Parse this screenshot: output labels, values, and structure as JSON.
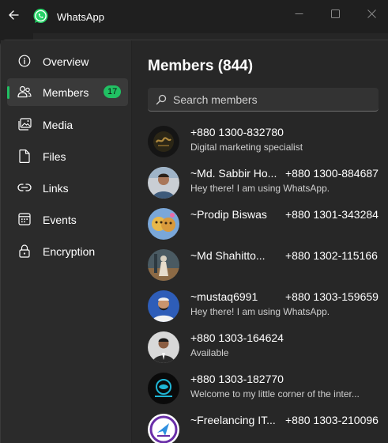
{
  "app": {
    "title": "WhatsApp"
  },
  "sidebar": {
    "items": [
      {
        "label": "Overview",
        "icon": "info-icon"
      },
      {
        "label": "Members",
        "icon": "people-icon",
        "badge": "17",
        "active": true
      },
      {
        "label": "Media",
        "icon": "media-icon"
      },
      {
        "label": "Files",
        "icon": "file-icon"
      },
      {
        "label": "Links",
        "icon": "link-icon"
      },
      {
        "label": "Events",
        "icon": "calendar-icon"
      },
      {
        "label": "Encryption",
        "icon": "lock-icon"
      }
    ]
  },
  "main": {
    "title": "Members (844)",
    "search": {
      "placeholder": "Search members"
    },
    "members": [
      {
        "name": "+880 1300-832780",
        "phone": "",
        "status": "Digital marketing specialist"
      },
      {
        "name": "~Md. Sabbir Ho...",
        "phone": "+880 1300-884687",
        "status": "Hey there! I am using WhatsApp."
      },
      {
        "name": "~Prodip Biswas",
        "phone": "+880 1301-343284",
        "status": ""
      },
      {
        "name": "~Md Shahitto...",
        "phone": "+880 1302-115166",
        "status": ""
      },
      {
        "name": "~mustaq6991",
        "phone": "+880 1303-159659",
        "status": "Hey there! I am using WhatsApp."
      },
      {
        "name": "+880 1303-164624",
        "phone": "",
        "status": "Available"
      },
      {
        "name": "+880 1303-182770",
        "phone": "",
        "status": "Welcome to my little corner of the inter..."
      },
      {
        "name": "~Freelancing IT...",
        "phone": "+880 1303-210096",
        "status": ""
      }
    ]
  },
  "colors": {
    "accent": "#21c063",
    "background": "#1f1f1f",
    "panel": "#2b2b2b",
    "content": "#272727"
  }
}
